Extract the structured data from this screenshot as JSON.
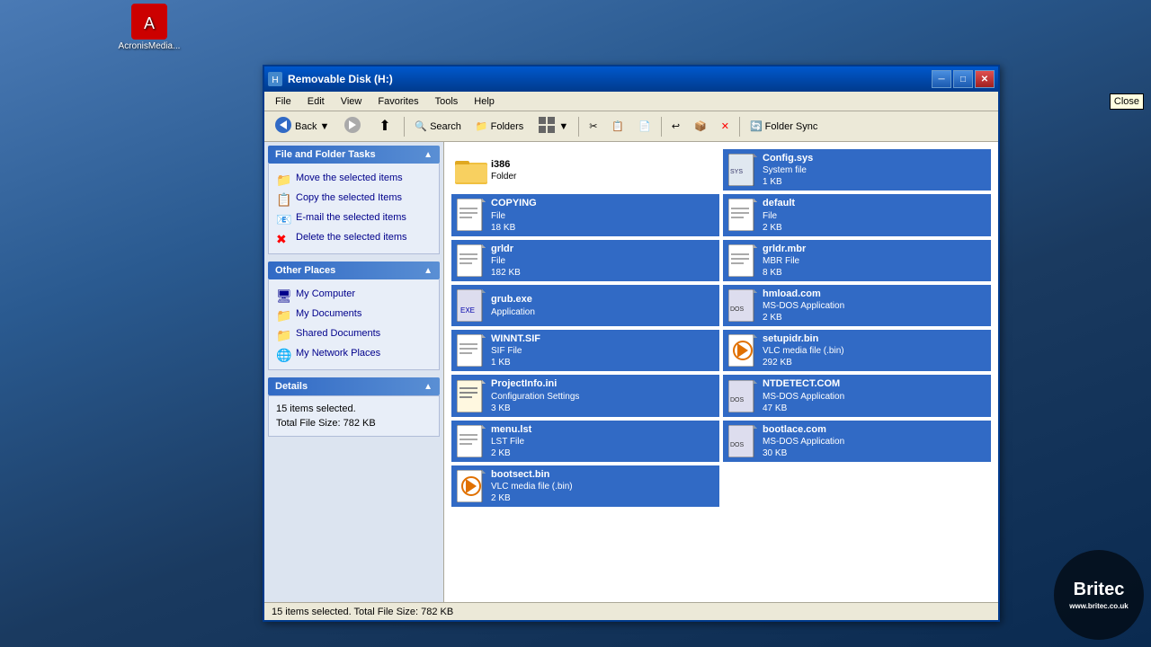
{
  "desktop": {
    "title": "Desktop",
    "background_color": "#2a5a90"
  },
  "window": {
    "title": "Removable Disk (H:)",
    "titlebar_icon": "💾",
    "buttons": {
      "minimize": "🗕",
      "maximize": "🗖",
      "close": "✕"
    }
  },
  "menubar": {
    "items": [
      "File",
      "Edit",
      "View",
      "Favorites",
      "Tools",
      "Help"
    ]
  },
  "toolbar": {
    "back_label": "Back",
    "search_label": "Search",
    "folders_label": "Folders",
    "folder_sync_label": "Folder Sync"
  },
  "left_panel": {
    "file_folder_tasks": {
      "header": "File and Folder Tasks",
      "items": [
        {
          "icon": "📁",
          "label": "Move the selected items"
        },
        {
          "icon": "📋",
          "label": "Copy the selected Items"
        },
        {
          "icon": "📧",
          "label": "E-mail the selected items"
        },
        {
          "icon": "✖",
          "label": "Delete the selected items"
        }
      ]
    },
    "other_places": {
      "header": "Other Places",
      "items": [
        {
          "icon": "🖥",
          "label": "My Computer"
        },
        {
          "icon": "📁",
          "label": "My Documents"
        },
        {
          "icon": "📁",
          "label": "Shared Documents"
        },
        {
          "icon": "🌐",
          "label": "My Network Places"
        }
      ]
    },
    "details": {
      "header": "Details",
      "items_selected": "15 items selected.",
      "total_size": "Total File Size: 782 KB"
    }
  },
  "files": [
    {
      "name": "i386",
      "type": "Folder",
      "size": "",
      "selected": false,
      "icon": "folder"
    },
    {
      "name": "Config.sys",
      "type": "System file",
      "size": "1 KB",
      "selected": true,
      "icon": "system"
    },
    {
      "name": "COPYING",
      "type": "File",
      "size": "18 KB",
      "selected": true,
      "icon": "text"
    },
    {
      "name": "default",
      "type": "File",
      "size": "2 KB",
      "selected": true,
      "icon": "text"
    },
    {
      "name": "grldr",
      "type": "File",
      "size": "182 KB",
      "selected": true,
      "icon": "text"
    },
    {
      "name": "grldr.mbr",
      "type": "MBR File",
      "size": "8 KB",
      "selected": true,
      "icon": "text"
    },
    {
      "name": "grub.exe",
      "type": "Application",
      "size": "",
      "selected": true,
      "icon": "exe"
    },
    {
      "name": "hmload.com",
      "type": "MS-DOS Application",
      "size": "2 KB",
      "selected": true,
      "icon": "dos"
    },
    {
      "name": "WINNT.SIF",
      "type": "SIF File",
      "size": "1 KB",
      "selected": true,
      "icon": "text"
    },
    {
      "name": "setupidr.bin",
      "type": "VLC media file (.bin)",
      "size": "292 KB",
      "selected": true,
      "icon": "vlc"
    },
    {
      "name": "ProjectInfo.ini",
      "type": "Configuration Settings",
      "size": "3 KB",
      "selected": true,
      "icon": "ini"
    },
    {
      "name": "NTDETECT.COM",
      "type": "MS-DOS Application",
      "size": "47 KB",
      "selected": true,
      "icon": "dos"
    },
    {
      "name": "menu.lst",
      "type": "LST File",
      "size": "2 KB",
      "selected": true,
      "icon": "text"
    },
    {
      "name": "bootlace.com",
      "type": "MS-DOS Application",
      "size": "30 KB",
      "selected": true,
      "icon": "dos"
    },
    {
      "name": "bootsect.bin",
      "type": "VLC media file (.bin)",
      "size": "2 KB",
      "selected": true,
      "icon": "vlc"
    }
  ],
  "statusbar": {
    "text": "15 items selected. Total File Size: 782 KB"
  },
  "watermark": {
    "title": "Britec",
    "subtitle": "www.britec.co.uk"
  },
  "tooltip": {
    "close": "Close"
  }
}
